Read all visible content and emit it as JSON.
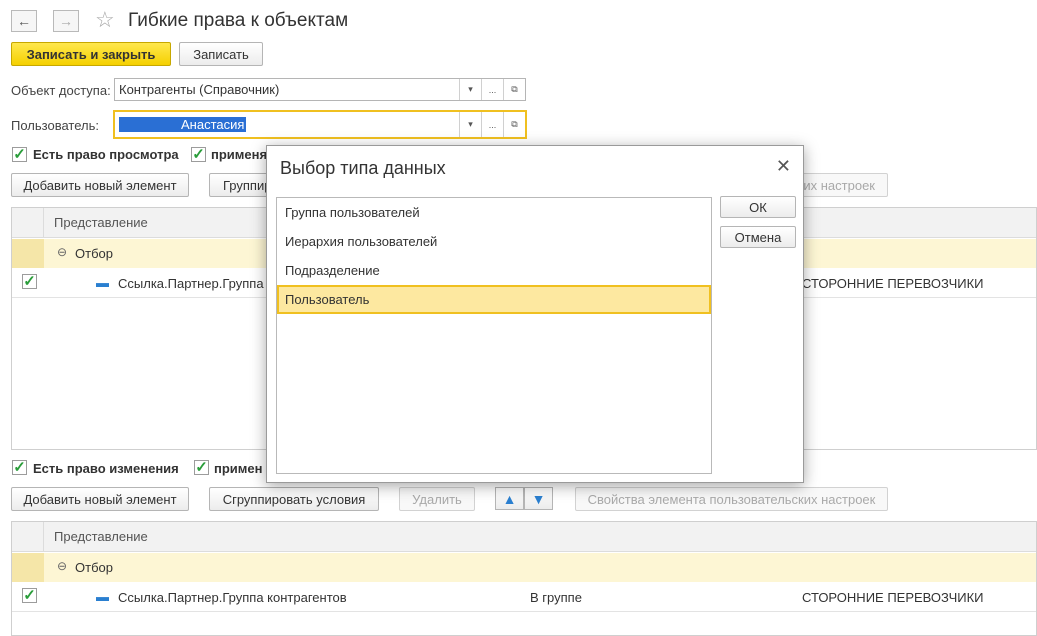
{
  "window": {
    "title": "Гибкие права к объектам",
    "back_icon": "←",
    "forward_icon": "→",
    "star_icon": "☆"
  },
  "toolbar": {
    "save_close_label": "Записать и закрыть",
    "save_label": "Записать"
  },
  "form": {
    "access_object_label": "Объект доступа:",
    "access_object_value": "Контрагенты (Справочник)",
    "user_label": "Пользователь:",
    "user_value": "Анастасия",
    "dropdown_icon": "▾",
    "ellipsis": "...",
    "open_icon": "⧉"
  },
  "section_view": {
    "checkbox_label": "Есть право просмотра",
    "checkbox2_label": "применя",
    "add_button": "Добавить новый элемент",
    "group_button": "Группировать условия",
    "props_button": "их настроек",
    "table": {
      "header": "Представление",
      "group_label": "Отбор",
      "row": {
        "field": "Ссылка.Партнер.Группа",
        "value": "СТОРОННИЕ ПЕРЕВОЗЧИКИ"
      }
    }
  },
  "section_edit": {
    "checkbox_label": "Есть право изменения",
    "checkbox2_label": "примен",
    "add_button": "Добавить новый элемент",
    "group_button": "Сгруппировать условия",
    "delete_button": "Удалить",
    "up_icon": "🡅",
    "down_icon": "🡇",
    "props_button": "Свойства элемента пользовательских настроек",
    "table": {
      "header": "Представление",
      "group_label": "Отбор",
      "row": {
        "field": "Ссылка.Партнер.Группа контрагентов",
        "condition": "В группе",
        "value": "СТОРОННИЕ ПЕРЕВОЗЧИКИ"
      }
    }
  },
  "dialog": {
    "title": "Выбор типа данных",
    "close_icon": "✕",
    "items": [
      "Группа пользователей",
      "Иерархия пользователей",
      "Подразделение",
      "Пользователь"
    ],
    "selected_index": 3,
    "ok_label": "ОК",
    "cancel_label": "Отмена"
  }
}
